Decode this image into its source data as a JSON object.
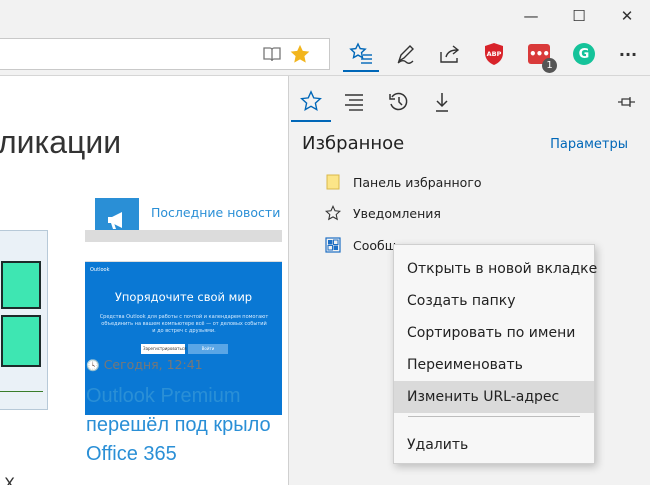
{
  "window": {
    "minimize": "—",
    "maximize": "☐",
    "close": "✕"
  },
  "toolbar": {
    "hub_icon": "hub-star-lines-icon",
    "pen_icon": "pen-icon",
    "share_icon": "share-icon",
    "adblock_icon": "adblock-icon",
    "adblock_text": "ABP",
    "ext_badge": "1",
    "grammarly_icon": "grammarly-icon",
    "grammarly_text": "G",
    "more_label": "···"
  },
  "page": {
    "heading": "ликации",
    "news_link": "Последние новости",
    "thumb": {
      "app_name": "Outlook",
      "title": "Упорядочите свой мир",
      "sub": "Средства Outlook для работы с почтой и календарем помогают объединить на вашем компьютере всё — от деловых событий и до встреч с друзьями.",
      "input": "Зарегистрироваться",
      "button": "Войти"
    },
    "date": "Сегодня, 12:41",
    "article_title": "Outlook Premium перешёл под крыло Office 365",
    "bottom_char": "Х"
  },
  "hub": {
    "title": "Избранное",
    "settings": "Параметры",
    "pin_icon": "pin-icon",
    "favorites": [
      {
        "label": "Панель избранного",
        "icon": "folder-icon"
      },
      {
        "label": "Уведомления",
        "icon": "star-outline-icon"
      },
      {
        "label": "Сообщ",
        "icon": "windows-tile-icon"
      }
    ]
  },
  "context_menu": {
    "items": [
      "Открыть в новой вкладке",
      "Создать папку",
      "Сортировать по имени",
      "Переименовать",
      "Изменить URL-адрес"
    ],
    "delete": "Удалить"
  },
  "colors": {
    "accent": "#0067b8",
    "link": "#2a8fd6",
    "star": "#f2b51d",
    "adblock": "#d8232a",
    "grammarly": "#15c39a",
    "ext_red": "#d93a3a"
  }
}
